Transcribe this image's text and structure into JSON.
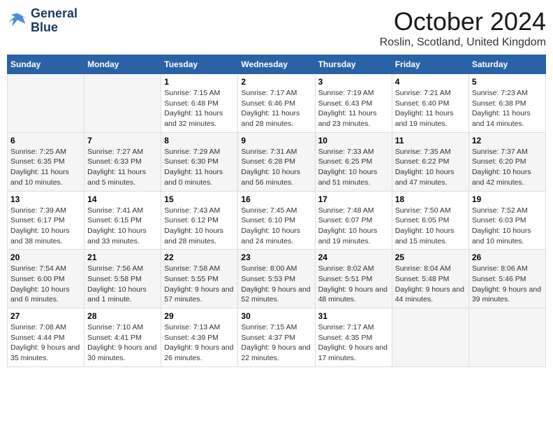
{
  "header": {
    "logo_line1": "General",
    "logo_line2": "Blue",
    "month": "October 2024",
    "location": "Roslin, Scotland, United Kingdom"
  },
  "weekdays": [
    "Sunday",
    "Monday",
    "Tuesday",
    "Wednesday",
    "Thursday",
    "Friday",
    "Saturday"
  ],
  "weeks": [
    [
      {
        "day": "",
        "info": ""
      },
      {
        "day": "",
        "info": ""
      },
      {
        "day": "1",
        "info": "Sunrise: 7:15 AM\nSunset: 6:48 PM\nDaylight: 11 hours and 32 minutes."
      },
      {
        "day": "2",
        "info": "Sunrise: 7:17 AM\nSunset: 6:46 PM\nDaylight: 11 hours and 28 minutes."
      },
      {
        "day": "3",
        "info": "Sunrise: 7:19 AM\nSunset: 6:43 PM\nDaylight: 11 hours and 23 minutes."
      },
      {
        "day": "4",
        "info": "Sunrise: 7:21 AM\nSunset: 6:40 PM\nDaylight: 11 hours and 19 minutes."
      },
      {
        "day": "5",
        "info": "Sunrise: 7:23 AM\nSunset: 6:38 PM\nDaylight: 11 hours and 14 minutes."
      }
    ],
    [
      {
        "day": "6",
        "info": "Sunrise: 7:25 AM\nSunset: 6:35 PM\nDaylight: 11 hours and 10 minutes."
      },
      {
        "day": "7",
        "info": "Sunrise: 7:27 AM\nSunset: 6:33 PM\nDaylight: 11 hours and 5 minutes."
      },
      {
        "day": "8",
        "info": "Sunrise: 7:29 AM\nSunset: 6:30 PM\nDaylight: 11 hours and 0 minutes."
      },
      {
        "day": "9",
        "info": "Sunrise: 7:31 AM\nSunset: 6:28 PM\nDaylight: 10 hours and 56 minutes."
      },
      {
        "day": "10",
        "info": "Sunrise: 7:33 AM\nSunset: 6:25 PM\nDaylight: 10 hours and 51 minutes."
      },
      {
        "day": "11",
        "info": "Sunrise: 7:35 AM\nSunset: 6:22 PM\nDaylight: 10 hours and 47 minutes."
      },
      {
        "day": "12",
        "info": "Sunrise: 7:37 AM\nSunset: 6:20 PM\nDaylight: 10 hours and 42 minutes."
      }
    ],
    [
      {
        "day": "13",
        "info": "Sunrise: 7:39 AM\nSunset: 6:17 PM\nDaylight: 10 hours and 38 minutes."
      },
      {
        "day": "14",
        "info": "Sunrise: 7:41 AM\nSunset: 6:15 PM\nDaylight: 10 hours and 33 minutes."
      },
      {
        "day": "15",
        "info": "Sunrise: 7:43 AM\nSunset: 6:12 PM\nDaylight: 10 hours and 28 minutes."
      },
      {
        "day": "16",
        "info": "Sunrise: 7:45 AM\nSunset: 6:10 PM\nDaylight: 10 hours and 24 minutes."
      },
      {
        "day": "17",
        "info": "Sunrise: 7:48 AM\nSunset: 6:07 PM\nDaylight: 10 hours and 19 minutes."
      },
      {
        "day": "18",
        "info": "Sunrise: 7:50 AM\nSunset: 6:05 PM\nDaylight: 10 hours and 15 minutes."
      },
      {
        "day": "19",
        "info": "Sunrise: 7:52 AM\nSunset: 6:03 PM\nDaylight: 10 hours and 10 minutes."
      }
    ],
    [
      {
        "day": "20",
        "info": "Sunrise: 7:54 AM\nSunset: 6:00 PM\nDaylight: 10 hours and 6 minutes."
      },
      {
        "day": "21",
        "info": "Sunrise: 7:56 AM\nSunset: 5:58 PM\nDaylight: 10 hours and 1 minute."
      },
      {
        "day": "22",
        "info": "Sunrise: 7:58 AM\nSunset: 5:55 PM\nDaylight: 9 hours and 57 minutes."
      },
      {
        "day": "23",
        "info": "Sunrise: 8:00 AM\nSunset: 5:53 PM\nDaylight: 9 hours and 52 minutes."
      },
      {
        "day": "24",
        "info": "Sunrise: 8:02 AM\nSunset: 5:51 PM\nDaylight: 9 hours and 48 minutes."
      },
      {
        "day": "25",
        "info": "Sunrise: 8:04 AM\nSunset: 5:48 PM\nDaylight: 9 hours and 44 minutes."
      },
      {
        "day": "26",
        "info": "Sunrise: 8:06 AM\nSunset: 5:46 PM\nDaylight: 9 hours and 39 minutes."
      }
    ],
    [
      {
        "day": "27",
        "info": "Sunrise: 7:08 AM\nSunset: 4:44 PM\nDaylight: 9 hours and 35 minutes."
      },
      {
        "day": "28",
        "info": "Sunrise: 7:10 AM\nSunset: 4:41 PM\nDaylight: 9 hours and 30 minutes."
      },
      {
        "day": "29",
        "info": "Sunrise: 7:13 AM\nSunset: 4:39 PM\nDaylight: 9 hours and 26 minutes."
      },
      {
        "day": "30",
        "info": "Sunrise: 7:15 AM\nSunset: 4:37 PM\nDaylight: 9 hours and 22 minutes."
      },
      {
        "day": "31",
        "info": "Sunrise: 7:17 AM\nSunset: 4:35 PM\nDaylight: 9 hours and 17 minutes."
      },
      {
        "day": "",
        "info": ""
      },
      {
        "day": "",
        "info": ""
      }
    ]
  ]
}
